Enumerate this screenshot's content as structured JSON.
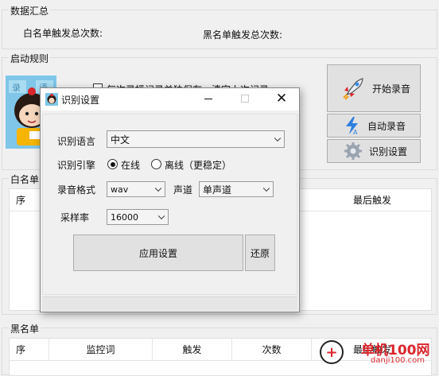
{
  "summary": {
    "title": "数据汇总",
    "whitelist_label": "白名单触发总次数:",
    "blacklist_label": "黑名单触发总次数:"
  },
  "startup": {
    "title": "启动规则",
    "checkbox_label": "每次录播记录单独保存，清空上次记录",
    "start_button": "开始录音",
    "auto_button": "自动录音",
    "settings_button": "识别设置"
  },
  "whitelist": {
    "title": "白名单",
    "columns": [
      "序",
      "最后触发"
    ]
  },
  "blacklist": {
    "title": "黑名单",
    "columns": [
      "序",
      "监控词",
      "触发",
      "次数",
      "最后触发"
    ]
  },
  "dialog": {
    "title": "识别设置",
    "language_label": "识别语言",
    "language_value": "中文",
    "engine_label": "识别引擎",
    "engine_online": "在线",
    "engine_offline": "离线（更稳定）",
    "engine_selected": "online",
    "format_label": "录音格式",
    "format_value": "wav",
    "channel_label": "声道",
    "channel_value": "单声道",
    "rate_label": "采样率",
    "rate_value": "16000",
    "apply_button": "应用设置",
    "restore_button": "还原"
  },
  "watermark": {
    "text": "单机100网",
    "url": "danji100.com"
  },
  "colors": {
    "background": "#f0f0f0",
    "watermark_red": "#d9262c"
  }
}
